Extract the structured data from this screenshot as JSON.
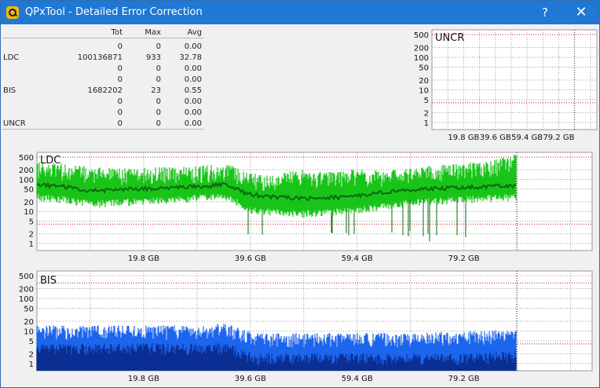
{
  "window": {
    "title": "QPxTool - Detailed Error Correction",
    "help_label": "?",
    "close_label": "✕",
    "icon": "magnifier-app-icon"
  },
  "stats": {
    "headers": {
      "tot": "Tot",
      "max": "Max",
      "avg": "Avg"
    },
    "rows": [
      {
        "label": "",
        "tot": "0",
        "max": "0",
        "avg": "0.00"
      },
      {
        "label": "LDC",
        "tot": "100136871",
        "max": "933",
        "avg": "32.78"
      },
      {
        "label": "",
        "tot": "0",
        "max": "0",
        "avg": "0.00"
      },
      {
        "label": "",
        "tot": "0",
        "max": "0",
        "avg": "0.00"
      },
      {
        "label": "BIS",
        "tot": "1682202",
        "max": "23",
        "avg": "0.55"
      },
      {
        "label": "",
        "tot": "0",
        "max": "0",
        "avg": "0.00"
      },
      {
        "label": "",
        "tot": "0",
        "max": "0",
        "avg": "0.00"
      },
      {
        "label": "UNCR",
        "tot": "0",
        "max": "0",
        "avg": "0.00"
      }
    ]
  },
  "colors": {
    "ldc_fill": "#19c419",
    "ldc_line": "#0c6a0c",
    "bis_fill": "#1c66ee",
    "bis_dark": "#0a2a8a",
    "limit_red": "#c01818",
    "grid": "#8a8a8a"
  },
  "chart_data": [
    {
      "type": "area",
      "title": "UNCR",
      "y_scale": "log",
      "y_ticks": [
        "500",
        "200",
        "100",
        "50",
        "20",
        "10",
        "5",
        "2",
        "1"
      ],
      "x_ticks": [
        "19.8 GB",
        "39.6 GB",
        "59.4 GB",
        "79.2 GB"
      ],
      "series": [
        {
          "values": [
            0,
            0,
            0,
            0,
            0
          ]
        }
      ]
    },
    {
      "type": "area",
      "title": "LDC",
      "y_scale": "log",
      "y_ticks": [
        "500",
        "200",
        "100",
        "50",
        "20",
        "10",
        "5",
        "2",
        "1"
      ],
      "x_ticks": [
        "19.8 GB",
        "39.6 GB",
        "59.4 GB",
        "79.2 GB"
      ],
      "x_gb": [
        0,
        5,
        10,
        15,
        20,
        25,
        30,
        35,
        39,
        44,
        49,
        54,
        59,
        64,
        69,
        74,
        79,
        84,
        89
      ],
      "peak": [
        300,
        250,
        200,
        180,
        190,
        200,
        210,
        260,
        130,
        120,
        160,
        140,
        170,
        150,
        200,
        220,
        260,
        300,
        500
      ],
      "avg": [
        70,
        60,
        45,
        48,
        52,
        55,
        60,
        70,
        35,
        28,
        25,
        26,
        30,
        40,
        48,
        52,
        56,
        60,
        65
      ],
      "low": [
        30,
        25,
        18,
        20,
        22,
        25,
        28,
        30,
        12,
        10,
        9,
        10,
        11,
        15,
        20,
        22,
        25,
        28,
        30
      ],
      "limits": [
        500,
        4
      ]
    },
    {
      "type": "area",
      "title": "BIS",
      "y_scale": "log",
      "y_ticks": [
        "500",
        "200",
        "100",
        "50",
        "20",
        "10",
        "5",
        "2",
        "1"
      ],
      "x_ticks": [
        "19.8 GB",
        "39.6 GB",
        "59.4 GB",
        "79.2 GB"
      ],
      "x_gb": [
        0,
        10,
        20,
        30,
        35,
        40,
        50,
        60,
        70,
        80,
        89
      ],
      "peak": [
        12,
        12,
        12,
        12,
        14,
        7,
        7,
        7,
        7,
        8,
        9
      ],
      "dark": [
        3,
        3,
        3,
        3,
        3,
        1.5,
        1.5,
        1.5,
        1.5,
        1.5,
        1.8
      ],
      "limits": [
        300,
        4
      ]
    }
  ]
}
